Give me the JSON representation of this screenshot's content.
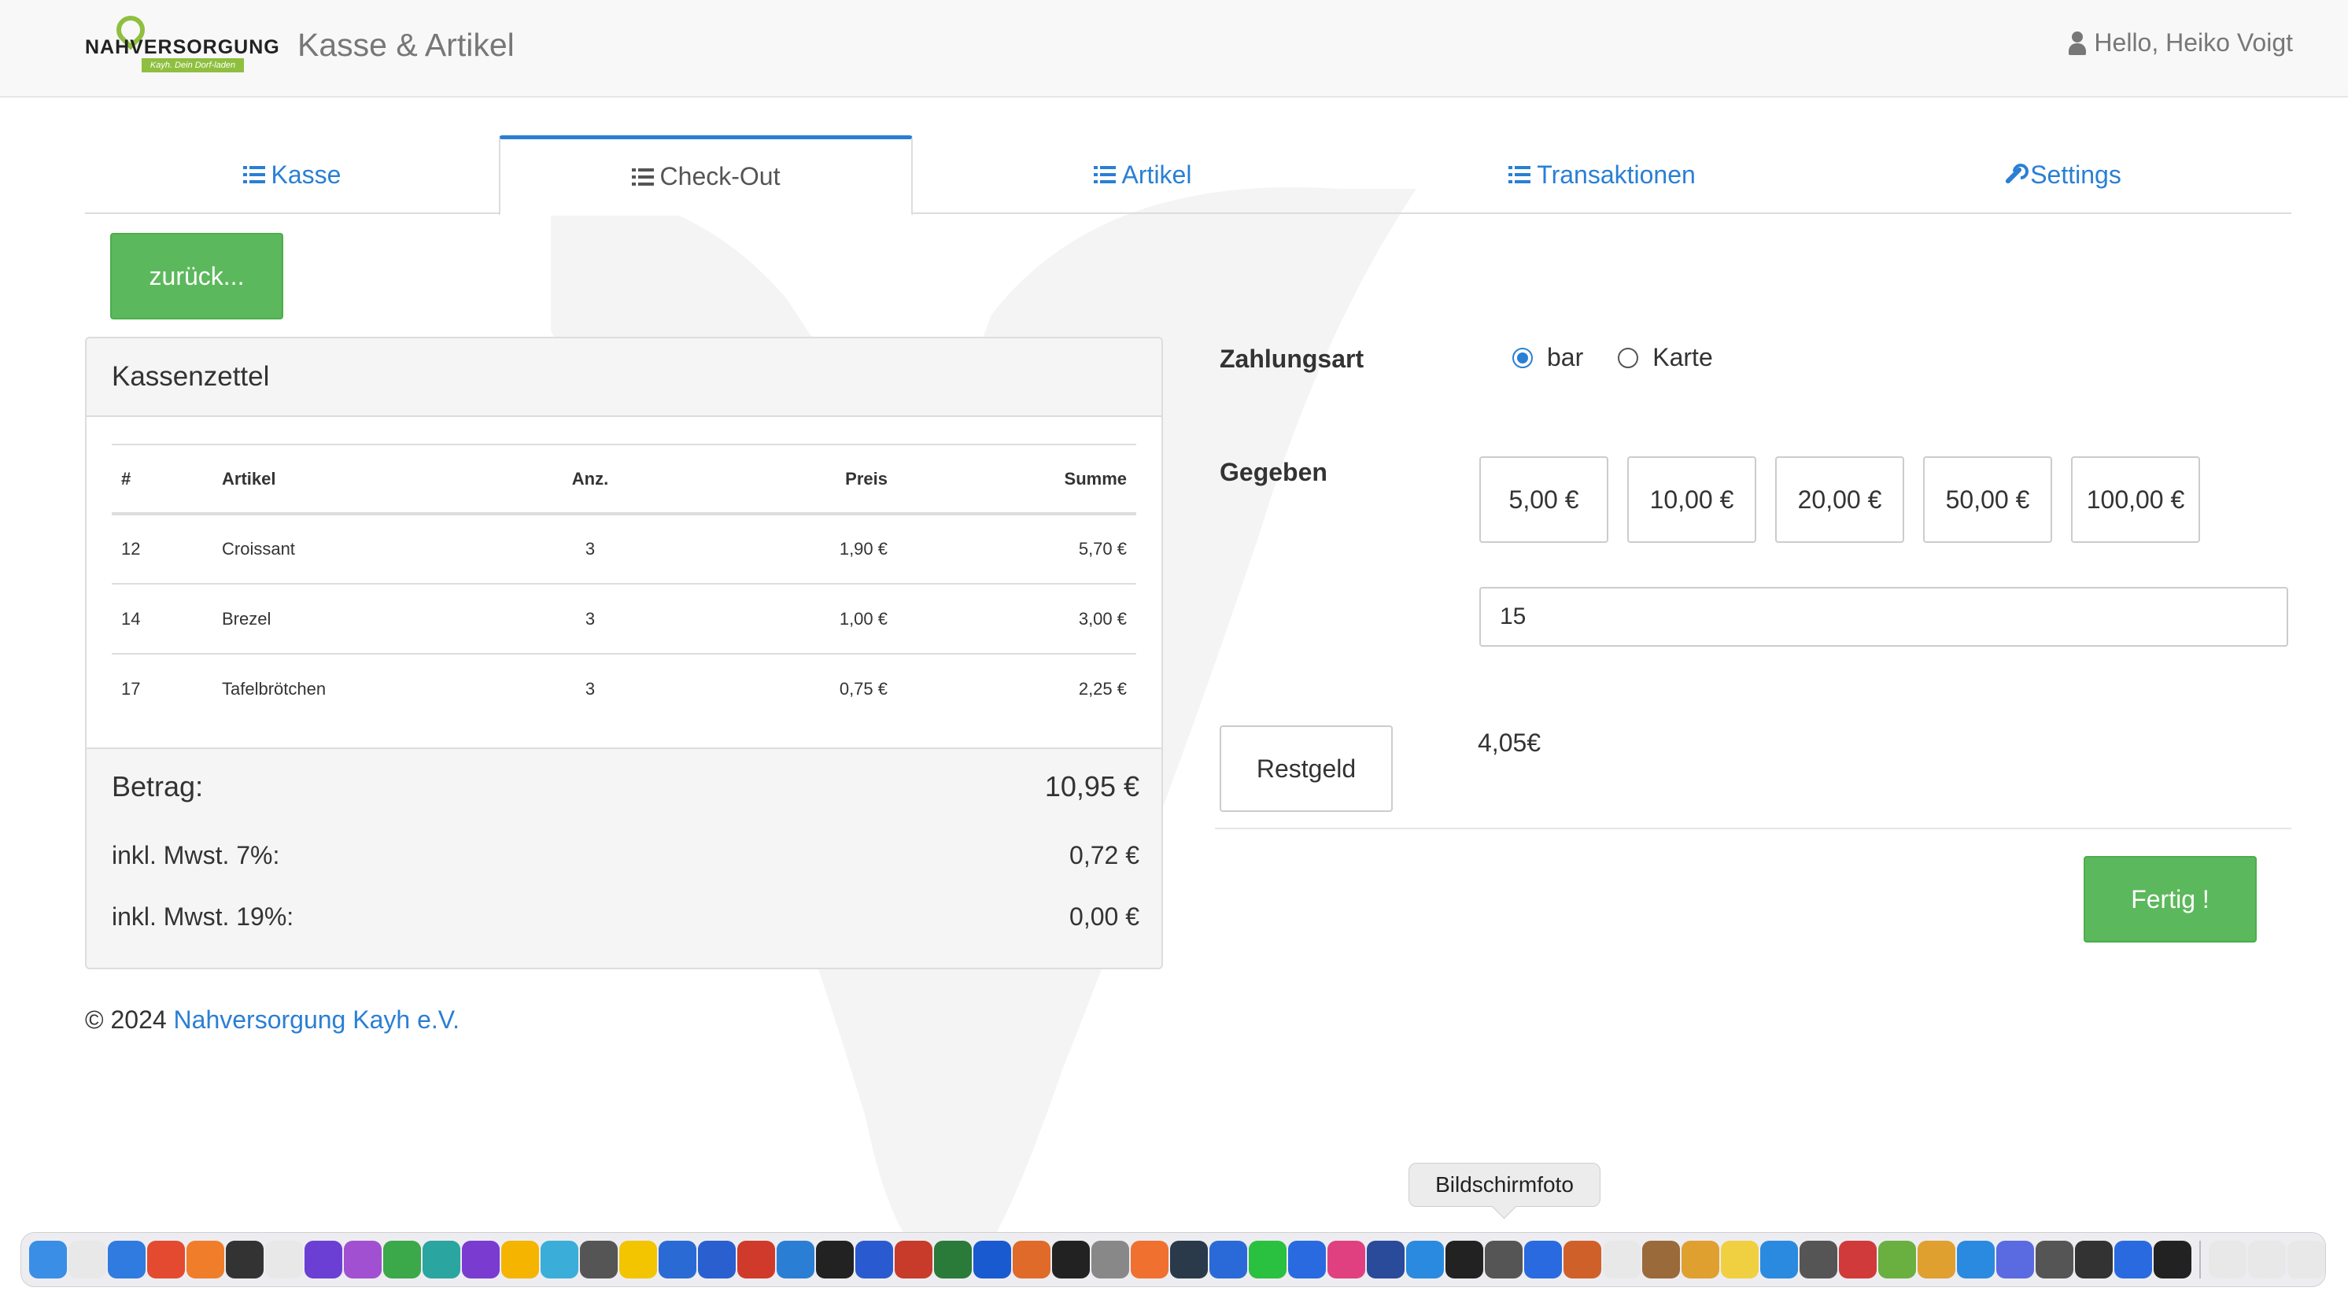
{
  "header": {
    "logo_text": "NAHVERSORGUNG",
    "logo_tagline": "Kayh. Dein Dorf-laden",
    "app_title": "Kasse & Artikel",
    "user_greeting": "Hello, Heiko Voigt"
  },
  "tabs": [
    {
      "label": "Kasse",
      "icon": "list-icon",
      "active": false
    },
    {
      "label": "Check-Out",
      "icon": "list-icon",
      "active": true
    },
    {
      "label": "Artikel",
      "icon": "list-icon",
      "active": false
    },
    {
      "label": "Transaktionen",
      "icon": "list-icon",
      "active": false
    },
    {
      "label": "Settings",
      "icon": "wrench-icon",
      "active": false
    }
  ],
  "back_button": "zurück...",
  "receipt": {
    "title": "Kassenzettel",
    "columns": [
      "#",
      "Artikel",
      "Anz.",
      "Preis",
      "Summe"
    ],
    "rows": [
      {
        "num": "12",
        "artikel": "Croissant",
        "anz": "3",
        "preis": "1,90 €",
        "summe": "5,70 €"
      },
      {
        "num": "14",
        "artikel": "Brezel",
        "anz": "3",
        "preis": "1,00 €",
        "summe": "3,00 €"
      },
      {
        "num": "17",
        "artikel": "Tafelbrötchen",
        "anz": "3",
        "preis": "0,75 €",
        "summe": "2,25 €"
      }
    ],
    "betrag_label": "Betrag:",
    "betrag_value": "10,95 €",
    "mwst7_label": "inkl. Mwst. 7%:",
    "mwst7_value": "0,72 €",
    "mwst19_label": "inkl. Mwst. 19%:",
    "mwst19_value": "0,00 €"
  },
  "payment": {
    "zahlungsart_label": "Zahlungsart",
    "options": [
      {
        "label": "bar",
        "checked": true
      },
      {
        "label": "Karte",
        "checked": false
      }
    ],
    "gegeben_label": "Gegeben",
    "quick_amounts": [
      "5,00 €",
      "10,00 €",
      "20,00 €",
      "50,00 €",
      "100,00 €"
    ],
    "given_value": "15",
    "restgeld_button": "Restgeld",
    "restgeld_value": "4,05€",
    "fertig_button": "Fertig !"
  },
  "footer": {
    "copyright": "© 2024 ",
    "link_text": "Nahversorgung Kayh e.V."
  },
  "dock": {
    "tooltip": "Bildschirmfoto",
    "icon_colors": [
      "#3a8ee6",
      "#e8e8e8",
      "#2f7be0",
      "#e34a2f",
      "#f07d2a",
      "#333",
      "#e8e8e8",
      "#6b3fd4",
      "#a050d0",
      "#3ba84a",
      "#2aa5a0",
      "#7a3bd0",
      "#f5b400",
      "#3aaed8",
      "#555",
      "#f3c400",
      "#2a6ad4",
      "#2a5fd0",
      "#d03a2a",
      "#2a7fd4",
      "#222",
      "#2a5ad0",
      "#c83a2a",
      "#2a7a3a",
      "#1a5ad0",
      "#e06a2a",
      "#222",
      "#888",
      "#f07030",
      "#2a3a4a",
      "#2a6ad8",
      "#2ac040",
      "#2a6ae0",
      "#e04080",
      "#2a4a9a",
      "#2a8ae0",
      "#222",
      "#555",
      "#2a6ae0",
      "#d0602a",
      "#e8e8e8",
      "#9a6a3a",
      "#e0a030",
      "#f0d040",
      "#2a8ae0",
      "#555",
      "#d03a3a",
      "#6ab040",
      "#e0a030",
      "#2a8ae0",
      "#5a6ae0",
      "#555",
      "#333",
      "#2a6ae0",
      "#222",
      "#e8e8e8",
      "#e8e8e8",
      "#e8e8e8"
    ]
  }
}
